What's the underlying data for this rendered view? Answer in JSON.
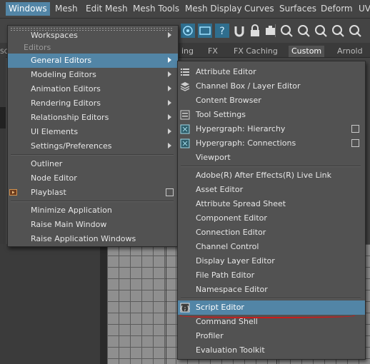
{
  "menubar": {
    "items": [
      "Windows",
      "Mesh",
      "Edit Mesh",
      "Mesh Tools",
      "Mesh Display",
      "Curves",
      "Surfaces",
      "Deform",
      "UV"
    ]
  },
  "background": {
    "tabs": [
      "ing",
      "FX",
      "FX Caching",
      "Custom",
      "Arnold"
    ],
    "left_text": "SO"
  },
  "windows_menu": {
    "items": {
      "workspaces": "Workspaces",
      "section_editors": "Editors",
      "general_editors": "General Editors",
      "modeling_editors": "Modeling Editors",
      "animation_editors": "Animation Editors",
      "rendering_editors": "Rendering Editors",
      "relationship_editors": "Relationship Editors",
      "ui_elements": "UI Elements",
      "settings_preferences": "Settings/Preferences",
      "outliner": "Outliner",
      "node_editor": "Node Editor",
      "playblast": "Playblast",
      "minimize_application": "Minimize Application",
      "raise_main_window": "Raise Main Window",
      "raise_application_windows": "Raise Application Windows"
    }
  },
  "general_editors_menu": {
    "items": {
      "attribute_editor": "Attribute Editor",
      "channel_box": "Channel Box / Layer Editor",
      "content_browser": "Content Browser",
      "tool_settings": "Tool Settings",
      "hypergraph_hierarchy": "Hypergraph: Hierarchy",
      "hypergraph_connections": "Hypergraph: Connections",
      "viewport": "Viewport",
      "after_effects_link": "Adobe(R) After Effects(R) Live Link",
      "asset_editor": "Asset Editor",
      "attribute_spread_sheet": "Attribute Spread Sheet",
      "component_editor": "Component Editor",
      "connection_editor": "Connection Editor",
      "channel_control": "Channel Control",
      "display_layer_editor": "Display Layer Editor",
      "file_path_editor": "File Path Editor",
      "namespace_editor": "Namespace Editor",
      "script_editor": "Script Editor",
      "command_shell": "Command Shell",
      "profiler": "Profiler",
      "evaluation_toolkit": "Evaluation Toolkit"
    }
  },
  "colors": {
    "highlight": "#5285a6",
    "menu_bg": "#525252",
    "annotation": "#cc1b1b"
  }
}
